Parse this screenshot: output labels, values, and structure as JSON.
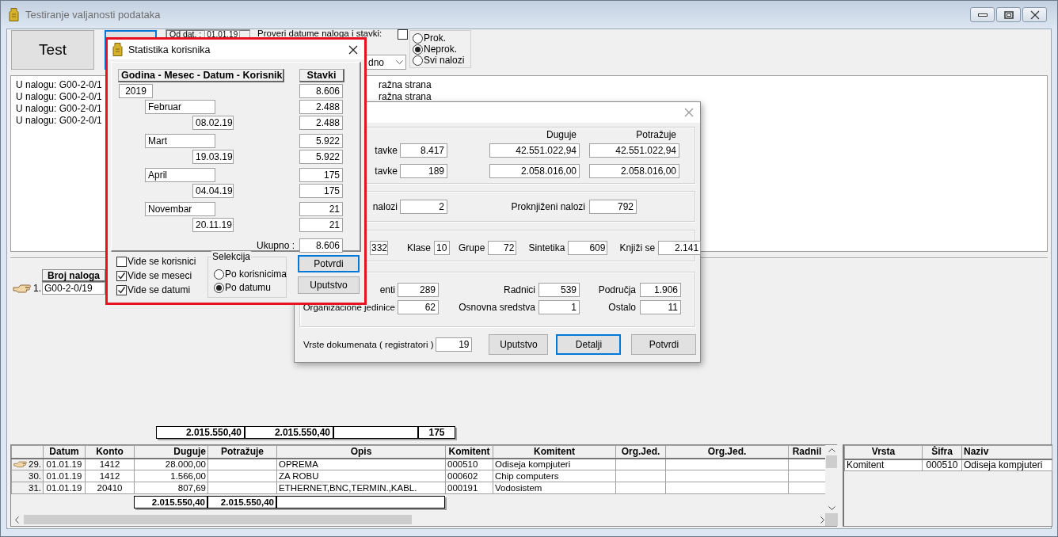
{
  "window": {
    "title": "Testiranje valjanosti podataka"
  },
  "toolbar": {
    "test_button": "Test",
    "date_label": "Od dat. :",
    "date_value": "01.01.19",
    "check": {
      "label": "Proveri datume naloga i stavki:",
      "checked": false
    },
    "dropdown_value": "dno",
    "filter": [
      {
        "label": "Prok.",
        "selected": false
      },
      {
        "label": "Neprok.",
        "selected": true
      },
      {
        "label": "Svi nalozi",
        "selected": false
      }
    ]
  },
  "log": {
    "lines": [
      {
        "left": "U nalogu: G00-2-0/1",
        "right": "ražna strana"
      },
      {
        "left": "U nalogu: G00-2-0/1",
        "right": "ražna strana"
      },
      {
        "left": "U nalogu: G00-2-0/1"
      },
      {
        "left": "U nalogu: G00-2-0/1"
      }
    ]
  },
  "orders": {
    "column": "Broj naloga",
    "rows": [
      {
        "number": "1.",
        "order": "G00-2-0/19",
        "current": true
      }
    ]
  },
  "totals": {
    "debit": "2.015.550,40",
    "credit": "2.015.550,40",
    "count": "175"
  },
  "items": {
    "columns": [
      "Datum",
      "Konto",
      "Duguje",
      "Potražuje",
      "Opis",
      "Komitent",
      "Komitent",
      "Org.Jed.",
      "Org.Jed.",
      "Radnil"
    ],
    "rows": [
      {
        "number": "29.",
        "current": true,
        "date": "01.01.19",
        "account": "1412",
        "debit": "28.000,00",
        "description": "OPREMA",
        "partner_code": "000510",
        "partner_name": "Odiseja kompjuteri"
      },
      {
        "number": "30.",
        "current": false,
        "date": "01.01.19",
        "account": "1412",
        "debit": "1.566,00",
        "description": "ZA ROBU",
        "partner_code": "000602",
        "partner_name": "Chip computers"
      },
      {
        "number": "31.",
        "current": false,
        "date": "01.01.19",
        "account": "20410",
        "debit": "807,69",
        "description": "ETHERNET,BNC,TERMIN.,KABL.",
        "partner_code": "000191",
        "partner_name": "Vodosistem"
      }
    ],
    "totals": {
      "debit": "2.015.550,40",
      "credit": "2.015.550,40"
    }
  },
  "partner": {
    "columns": [
      "Vrsta",
      "Šifra",
      "Naziv"
    ],
    "rows": [
      {
        "kind_name": "Komitent",
        "code": "000510",
        "name": "Odiseja kompjuteri"
      }
    ]
  },
  "stats_dialog": {
    "title": "Statistika korisnika",
    "headers": [
      "Godina - Mesec - Datum -  Korisnik",
      "Stavki"
    ],
    "tree": [
      {
        "label": "2019",
        "count": "8.606",
        "children": [
          {
            "label": "Februar",
            "count": "2.488",
            "children": [
              {
                "label": "08.02.19",
                "count": "2.488"
              }
            ]
          },
          {
            "label": "Mart",
            "count": "5.922",
            "children": [
              {
                "label": "19.03.19",
                "count": "5.922"
              }
            ]
          },
          {
            "label": "April",
            "count": "175",
            "children": [
              {
                "label": "04.04.19",
                "count": "175"
              }
            ]
          },
          {
            "label": "Novembar",
            "count": "21",
            "children": [
              {
                "label": "20.11.19",
                "count": "21"
              }
            ]
          }
        ]
      }
    ],
    "total_label": "Ukupno :",
    "total": "8.606",
    "options": [
      {
        "label": "Vide se korisnici",
        "checked": false
      },
      {
        "label": "Vide se meseci",
        "checked": true
      },
      {
        "label": "Vide se datumi",
        "checked": true
      }
    ],
    "selection": {
      "title": "Selekcija",
      "options": [
        {
          "label": "Po korisnicima",
          "selected": false
        },
        {
          "label": "Po datumu",
          "selected": true
        }
      ]
    },
    "buttons": [
      {
        "label": "Potvrdi",
        "focused": true
      },
      {
        "label": "Uputstvo",
        "focused": false
      }
    ]
  },
  "summary_dialog": {
    "amount_columns": [
      "Duguje",
      "Potražuje"
    ],
    "entries": [
      {
        "label": "tavke",
        "count": "8.417",
        "debit": "42.551.022,94",
        "credit": "42.551.022,94"
      },
      {
        "label": "tavke",
        "count": "189",
        "debit": "2.058.016,00",
        "credit": "2.058.016,00"
      }
    ],
    "orders": [
      {
        "label": "nalozi",
        "value": "2"
      },
      {
        "label": "Proknjiženi nalozi",
        "value": "792"
      }
    ],
    "accounts": {
      "partial_value": "332",
      "items": [
        {
          "label": "Klase",
          "value": "10"
        },
        {
          "label": "Grupe",
          "value": "72"
        },
        {
          "label": "Sintetika",
          "value": "609"
        },
        {
          "label": "Knjiži se",
          "value": "2.141"
        }
      ]
    },
    "registers": [
      {
        "label": "enti",
        "value": "289"
      },
      {
        "label": "Radnici",
        "value": "539"
      },
      {
        "label": "Područja",
        "value": "1.906"
      },
      {
        "label": "Organizacione jedinice",
        "value": "62"
      },
      {
        "label": "Osnovna sredstva",
        "value": "1"
      },
      {
        "label": "Ostalo",
        "value": "11"
      }
    ],
    "doc_types": {
      "label": "Vrste dokumenata  ( registratori )",
      "value": "19"
    },
    "buttons": [
      {
        "label": "Uputstvo",
        "focused": false
      },
      {
        "label": "Detalji",
        "focused": true
      },
      {
        "label": "Potvrdi",
        "focused": false
      }
    ]
  }
}
